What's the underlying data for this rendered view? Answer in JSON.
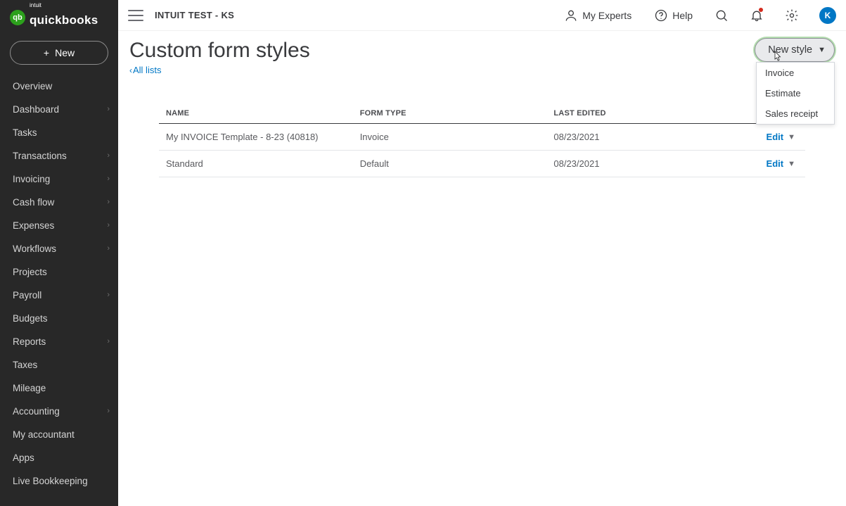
{
  "brand": {
    "logo_letters": "qb",
    "logo_sup": "intuit",
    "logo_name": "quickbooks"
  },
  "sidebar": {
    "new_label": "New",
    "items": [
      {
        "label": "Overview",
        "submenu": false
      },
      {
        "label": "Dashboard",
        "submenu": true
      },
      {
        "label": "Tasks",
        "submenu": false
      },
      {
        "label": "Transactions",
        "submenu": true
      },
      {
        "label": "Invoicing",
        "submenu": true
      },
      {
        "label": "Cash flow",
        "submenu": true
      },
      {
        "label": "Expenses",
        "submenu": true
      },
      {
        "label": "Workflows",
        "submenu": true
      },
      {
        "label": "Projects",
        "submenu": false
      },
      {
        "label": "Payroll",
        "submenu": true
      },
      {
        "label": "Budgets",
        "submenu": false
      },
      {
        "label": "Reports",
        "submenu": true
      },
      {
        "label": "Taxes",
        "submenu": false
      },
      {
        "label": "Mileage",
        "submenu": false
      },
      {
        "label": "Accounting",
        "submenu": true
      },
      {
        "label": "My accountant",
        "submenu": false
      },
      {
        "label": "Apps",
        "submenu": false
      },
      {
        "label": "Live Bookkeeping",
        "submenu": false
      }
    ]
  },
  "header": {
    "company_name": "INTUIT TEST - KS",
    "my_experts": "My Experts",
    "help": "Help",
    "avatar_initial": "K"
  },
  "page": {
    "title": "Custom form styles",
    "all_lists": "All lists",
    "new_style_label": "New style"
  },
  "dropdown": {
    "items": [
      {
        "label": "Invoice"
      },
      {
        "label": "Estimate"
      },
      {
        "label": "Sales receipt"
      }
    ]
  },
  "table": {
    "columns": {
      "name": "NAME",
      "form_type": "FORM TYPE",
      "last_edited": "LAST EDITED"
    },
    "edit_label": "Edit",
    "rows": [
      {
        "name": "My INVOICE Template - 8-23 (40818)",
        "form_type": "Invoice",
        "last_edited": "08/23/2021"
      },
      {
        "name": "Standard",
        "form_type": "Default",
        "last_edited": "08/23/2021"
      }
    ]
  }
}
